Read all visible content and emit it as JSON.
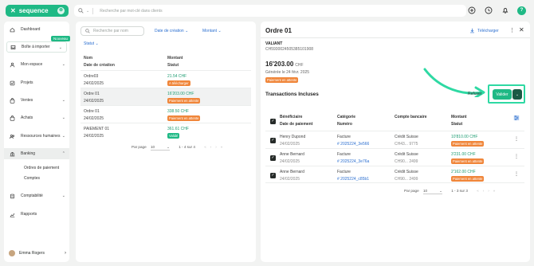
{
  "topbar": {
    "brand": "sequence",
    "brand_badge": "⊗",
    "search_placeholder": "Recherche par mot-clé dans clients",
    "avatar_letter": "?"
  },
  "sidebar": {
    "items": [
      {
        "label": "Dashboard",
        "icon": "home-icon"
      },
      {
        "label": "Boîte à importer",
        "icon": "inbox-icon",
        "badge": "Nouveau"
      },
      {
        "label": "Mon espace",
        "icon": "person-icon"
      },
      {
        "label": "Projets",
        "icon": "checkbox-icon"
      },
      {
        "label": "Ventes",
        "icon": "bag-icon"
      },
      {
        "label": "Achats",
        "icon": "bag-icon"
      },
      {
        "label": "Ressources humaines",
        "icon": "people-icon"
      },
      {
        "label": "Banking",
        "icon": "bank-icon"
      },
      {
        "label": "Comptabilité",
        "icon": "ledger-icon"
      },
      {
        "label": "Rapports",
        "icon": "chart-icon"
      }
    ],
    "banking_sub": [
      "Ordres de paiement",
      "Comptes"
    ],
    "user_name": "Emma Rogers"
  },
  "list": {
    "search_placeholder": "Recherche par nom",
    "filter_date": "Date de création",
    "filter_amount": "Montant",
    "sort_label": "Statut",
    "col_name": "Nom",
    "col_date": "Date de création",
    "col_amount": "Montant",
    "col_status": "Statut",
    "rows": [
      {
        "name": "Ordre03",
        "date": "24/02/2025",
        "amount": "21.54 CHF",
        "status": "A télécharger",
        "status_color": "orange"
      },
      {
        "name": "Ordre 01",
        "date": "24/02/2025",
        "amount": "16'203.00 CHF",
        "status": "Paiement en attente",
        "status_color": "orange"
      },
      {
        "name": "Ordre 01",
        "date": "24/02/2025",
        "amount": "338.50 CHF",
        "status": "Paiement en attente",
        "status_color": "orange"
      },
      {
        "name": "PAIEMENT 01",
        "date": "24/02/2025",
        "amount": "361.61 CHF",
        "status": "Validé",
        "status_color": "green"
      }
    ],
    "per_page_label": "Par page",
    "per_page_value": "10",
    "range": "1 - 4 sur 4"
  },
  "detail": {
    "title": "Ordre 01",
    "download_label": "Télécharger",
    "vendor": "VALIANT",
    "iban": "CH5930024505385101908",
    "amount": "16'203.00",
    "currency": "CHF",
    "generated": "Générée le 24 févr. 2025",
    "status": "Paiement en attente",
    "transactions_title": "Transactions Incluses",
    "refuse_label": "Refuser",
    "validate_label": "Valider",
    "col_beneficiary": "Bénéficiaire",
    "col_payment_date": "Date de paiement",
    "col_category": "Catégorie",
    "col_number": "Numéro",
    "col_bank": "Compte bancaire",
    "col_amount": "Montant",
    "col_status": "Statut",
    "transactions": [
      {
        "beneficiary": "Henry Dupond",
        "date": "24/02/2025",
        "category": "Facture",
        "number": "# 2025224_3e566",
        "bank": "Crédit Suisse",
        "account": "CH43... 9775",
        "amount": "10'810.00 CHF",
        "status": "Paiement en attente"
      },
      {
        "beneficiary": "Anne Bernard",
        "date": "24/02/2025",
        "category": "Facture",
        "number": "# 2025224_3e76a",
        "bank": "Crédit Suisse",
        "account": "CH90... 2499",
        "amount": "3'231.00 CHF",
        "status": "Paiement en attente"
      },
      {
        "beneficiary": "Anne Bernard",
        "date": "24/02/2025",
        "category": "Facture",
        "number": "# 2025224_c85b1",
        "bank": "Crédit Suisse",
        "account": "CH90... 2499",
        "amount": "2'162.00 CHF",
        "status": "Paiement en attente"
      }
    ],
    "per_page_label": "Par page",
    "per_page_value": "10",
    "range": "1 - 3 sur 3"
  },
  "colors": {
    "brand": "#1fb985",
    "pending": "#f0863a",
    "highlight": "#2ed9a3",
    "link": "#2b6fd0"
  }
}
